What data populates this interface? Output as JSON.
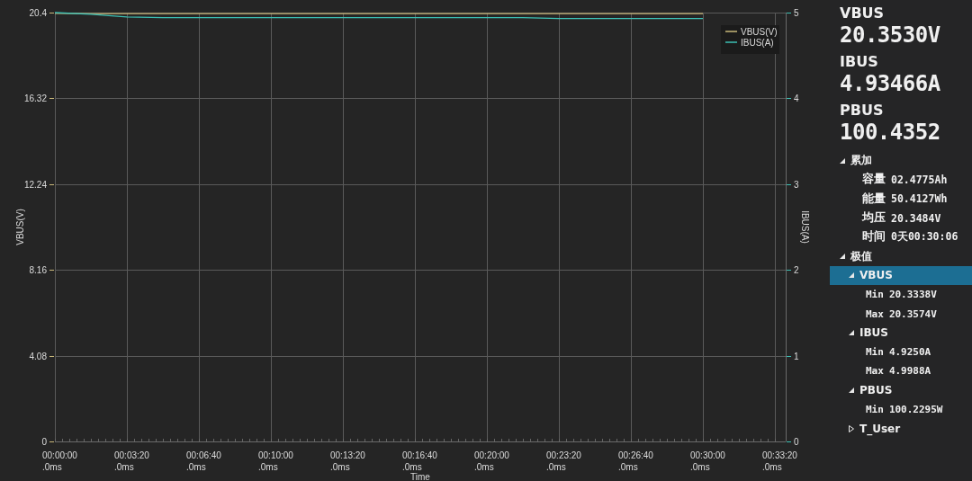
{
  "chart": {
    "chart_data": {
      "type": "line",
      "grid": true,
      "legend": "top-right",
      "xlabel": "Time",
      "ylabel": "VBUS(V)",
      "y2label": "IBUS(A)",
      "categories": [
        "00:00:00\n.0ms",
        null,
        "00:03:20\n.0ms",
        null,
        "00:06:40\n.0ms",
        null,
        "00:10:00\n.0ms",
        null,
        "00:13:20\n.0ms",
        null,
        "00:16:40\n.0ms",
        null,
        "00:20:00\n.0ms",
        null,
        "00:23:20\n.0ms",
        null,
        "00:26:40\n.0ms",
        null,
        "00:30:00\n.0ms",
        null,
        "00:33:20\n.0ms"
      ],
      "series": [
        {
          "name": "VBUS(V)",
          "color": "#c9b87a",
          "values": [
            20.36,
            20.35,
            20.35,
            20.35,
            20.35,
            20.35,
            20.35,
            20.35,
            20.35,
            20.35,
            20.35,
            20.35,
            20.35,
            20.35,
            20.35,
            20.35,
            20.35,
            20.35,
            20.35,
            null,
            null
          ]
        },
        {
          "name": "IBUS(A)",
          "color": "#3cc0b4",
          "axis": "y2",
          "values": [
            5.0,
            4.98,
            4.95,
            4.94,
            4.94,
            4.94,
            4.94,
            4.94,
            4.94,
            4.94,
            4.94,
            4.94,
            4.94,
            4.94,
            4.93,
            4.93,
            4.93,
            4.93,
            4.93,
            null,
            null
          ]
        }
      ],
      "ylim": [
        0,
        20.4
      ],
      "y2lim": [
        0,
        5
      ],
      "yticks": [
        {
          "value": 0,
          "label": "0"
        },
        {
          "value": 4.08,
          "label": "4.08"
        },
        {
          "value": 8.16,
          "label": "8.16"
        },
        {
          "value": 12.24,
          "label": "12.24"
        },
        {
          "value": 16.32,
          "label": "16.32"
        },
        {
          "value": 20.4,
          "label": "20.4"
        }
      ],
      "y2ticks": [
        {
          "value": 0,
          "label": "0"
        },
        {
          "value": 1,
          "label": "1"
        },
        {
          "value": 2,
          "label": "2"
        },
        {
          "value": 3,
          "label": "3"
        },
        {
          "value": 4,
          "label": "4"
        },
        {
          "value": 5,
          "label": "5"
        }
      ]
    }
  },
  "readouts": [
    {
      "label": "VBUS",
      "value": "20.3530V"
    },
    {
      "label": "IBUS",
      "value": "4.93466A"
    },
    {
      "label": "PBUS",
      "value": "100.4352"
    }
  ],
  "tree": [
    {
      "label": "累加",
      "expanded": true,
      "selected": false,
      "children": [
        {
          "label": "容量",
          "value": "02.4775Ah",
          "selected": false
        },
        {
          "label": "能量",
          "value": "50.4127Wh",
          "selected": false
        },
        {
          "label": "均压",
          "value": "20.3484V",
          "selected": false
        },
        {
          "label": "时间",
          "value": "0天00:30:06",
          "selected": false
        }
      ]
    },
    {
      "label": "极值",
      "expanded": true,
      "selected": false,
      "children": [
        {
          "label": "VBUS",
          "expanded": true,
          "selected": true,
          "children": [
            {
              "label": "Min",
              "value": "20.3338V",
              "selected": false
            },
            {
              "label": "Max",
              "value": "20.3574V",
              "selected": false
            }
          ]
        },
        {
          "label": "IBUS",
          "expanded": true,
          "selected": false,
          "children": [
            {
              "label": "Min",
              "value": "4.9250A",
              "selected": false
            },
            {
              "label": "Max",
              "value": "4.9988A",
              "selected": false
            }
          ]
        },
        {
          "label": "PBUS",
          "expanded": true,
          "selected": false,
          "children": [
            {
              "label": "Min",
              "value": "100.2295W",
              "selected": false
            }
          ]
        },
        {
          "label": "T_User",
          "expanded": false,
          "selected": false
        }
      ]
    }
  ]
}
